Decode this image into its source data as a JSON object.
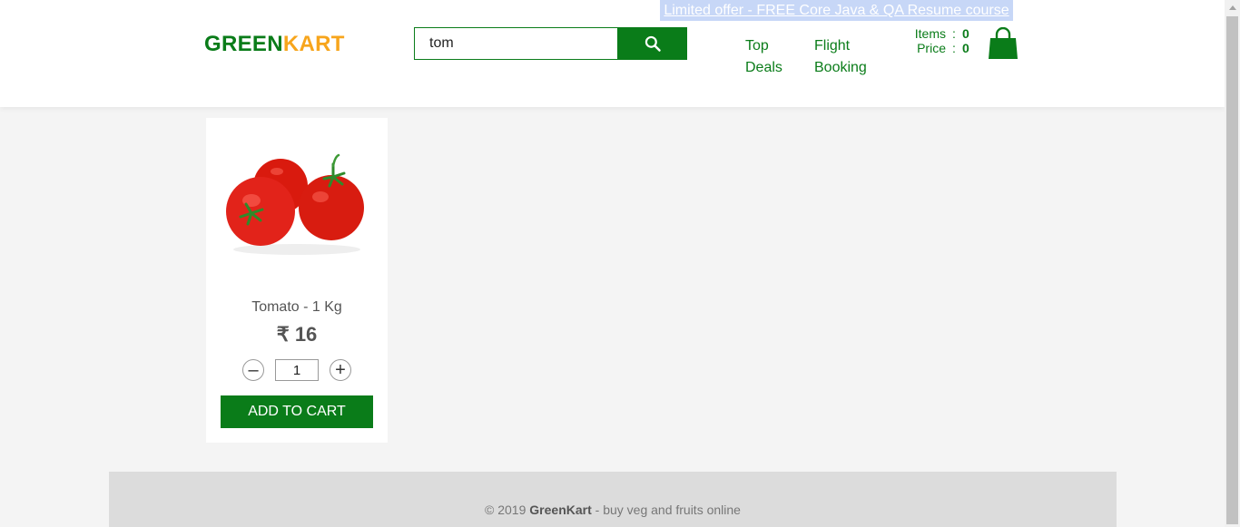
{
  "header": {
    "promo_text": "Limited offer - FREE Core Java & QA Resume course",
    "brand_left": "GREEN",
    "brand_right": "KART",
    "search_value": "tom",
    "nav": {
      "top_deals": "Top Deals",
      "flight_booking": "Flight Booking"
    },
    "cart": {
      "items_label": "Items",
      "items_value": "0",
      "price_label": "Price",
      "price_value": "0",
      "separator": ":"
    }
  },
  "products": [
    {
      "name": "Tomato - 1 Kg",
      "price": "₹ 16",
      "quantity": "1",
      "decrement_symbol": "–",
      "increment_symbol": "+",
      "add_label": "ADD TO CART",
      "image_icon": "tomato-image"
    }
  ],
  "footer": {
    "prefix": "© 2019 ",
    "brand": "GreenKart",
    "suffix": " - buy veg and fruits online"
  },
  "colors": {
    "brand_green": "#0a7c19",
    "brand_orange": "#f7a51c",
    "promo_bg": "#c7d7f7"
  }
}
